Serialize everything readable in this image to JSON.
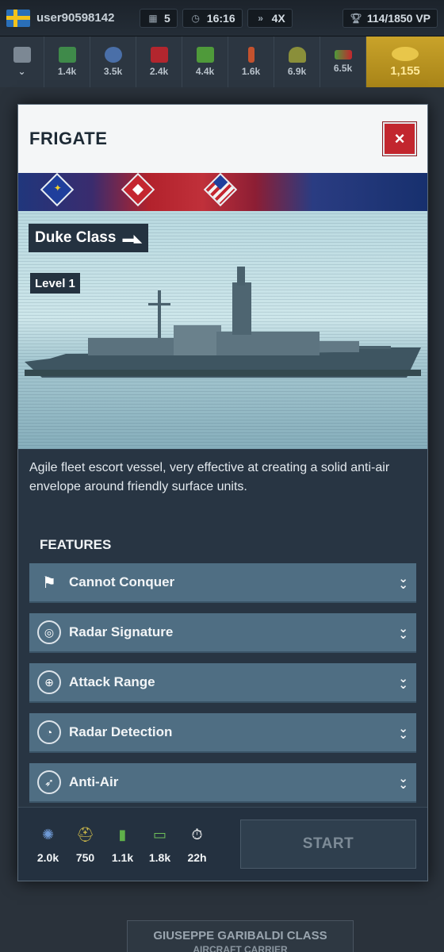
{
  "topbar": {
    "username": "user90598142",
    "stats": [
      {
        "icon": "calendar-icon",
        "value": "5"
      },
      {
        "icon": "clock-icon",
        "value": "16:16"
      },
      {
        "icon": "speed-icon",
        "value": "4X"
      }
    ],
    "victory_points": "114/1850 VP"
  },
  "resources": [
    {
      "name": "components-icon",
      "value": "1.4k"
    },
    {
      "name": "electronics-icon",
      "value": "3.5k"
    },
    {
      "name": "fuel-icon",
      "value": "2.4k"
    },
    {
      "name": "supplies-icon",
      "value": "4.4k"
    },
    {
      "name": "ammo-icon",
      "value": "1.6k"
    },
    {
      "name": "manpower-icon",
      "value": "6.9k"
    },
    {
      "name": "money-icon",
      "value": "6.5k"
    }
  ],
  "gold": {
    "value": "1,155"
  },
  "background": {
    "card_title": "GIUSEPPE GARIBALDI CLASS",
    "card_subtitle": "AIRCRAFT CARRIER"
  },
  "modal": {
    "title": "FRIGATE",
    "close_label": "×",
    "class_name": "Duke Class",
    "level": "Level 1",
    "description": "Agile fleet escort vessel, very effective at creating a solid anti-air envelope around friendly surface units.",
    "features_heading": "FEATURES",
    "features": [
      {
        "label": "Cannot Conquer",
        "icon": "no-conquer-flag-icon"
      },
      {
        "label": "Radar Signature",
        "icon": "radar-signature-icon"
      },
      {
        "label": "Attack Range",
        "icon": "crosshair-icon"
      },
      {
        "label": "Radar Detection",
        "icon": "radar-detection-icon"
      },
      {
        "label": "Anti-Air",
        "icon": "missile-icon"
      }
    ],
    "costs": [
      {
        "icon": "electronics-icon",
        "value": "2.0k"
      },
      {
        "icon": "manpower-icon",
        "value": "750"
      },
      {
        "icon": "supplies-icon",
        "value": "1.1k"
      },
      {
        "icon": "money-icon",
        "value": "1.8k"
      },
      {
        "icon": "timer-icon",
        "value": "22h"
      }
    ],
    "start_label": "START"
  },
  "colors": {
    "close_button": "#c2262e",
    "feature_row": "#4f6e83",
    "gold": "#c9a32a"
  }
}
